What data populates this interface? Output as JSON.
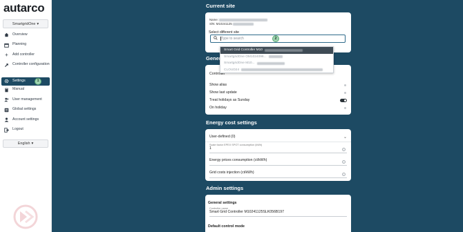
{
  "app": {
    "logo": "autarco"
  },
  "sidebar": {
    "account_label": "SmartgridOne",
    "items": [
      {
        "label": "Overview",
        "icon": "home-icon"
      },
      {
        "label": "Planning",
        "icon": "calendar-icon"
      },
      {
        "label": "Add controller",
        "icon": "plus-icon"
      },
      {
        "label": "Controller configuration",
        "icon": "tools-icon"
      },
      {
        "label": "Settings",
        "icon": "gear-icon",
        "active": true,
        "badge": "1"
      },
      {
        "label": "Manual",
        "icon": "book-icon"
      },
      {
        "label": "User management",
        "icon": "users-icon"
      },
      {
        "label": "Global settings",
        "icon": "globe-icon"
      },
      {
        "label": "Account settings",
        "icon": "user-icon"
      },
      {
        "label": "Logout",
        "icon": "logout-icon"
      }
    ],
    "language": "English"
  },
  "current_site": {
    "title": "Current site",
    "name_label": "Name:",
    "sn_label": "S/N:",
    "sn_prefix": "M10241125",
    "select_label": "Select different site",
    "search_placeholder": "Type to search",
    "badge": "2",
    "dropdown_items": [
      {
        "label": "Smart Grid Controller M10",
        "selected": true
      },
      {
        "label": "SmartgridOne OM1024096..."
      },
      {
        "label": "SmartgridOne M10..."
      },
      {
        "label": "CLOUD24"
      }
    ]
  },
  "general": {
    "title": "General",
    "controller_label": "Controller",
    "rows": [
      {
        "label": "Show alias",
        "state": "off"
      },
      {
        "label": "Show last update",
        "state": "off"
      },
      {
        "label": "Treat holidays as Sunday",
        "state": "on"
      },
      {
        "label": "On holiday",
        "state": "off"
      }
    ]
  },
  "energy": {
    "title": "Energy cost settings",
    "mode": "User-defined (0)",
    "scale_label": "Scale factor EPEX SPOT consumption (kWh)",
    "scale_value": "1",
    "prices_label": "Energy prices consumption (ct/kWh)",
    "injection_label": "Grid costs injection (ct/kWh)"
  },
  "admin": {
    "title": "Admin settings",
    "general_label": "General settings",
    "controller_name_label": "Controller name",
    "controller_name_value": "Smart Grid Controller M10241125SLK056B197",
    "default_mode_label": "Default control mode"
  },
  "colors": {
    "background": "#1d4a63",
    "accent": "#2e6a8a",
    "badge": "#9fd4b1"
  }
}
